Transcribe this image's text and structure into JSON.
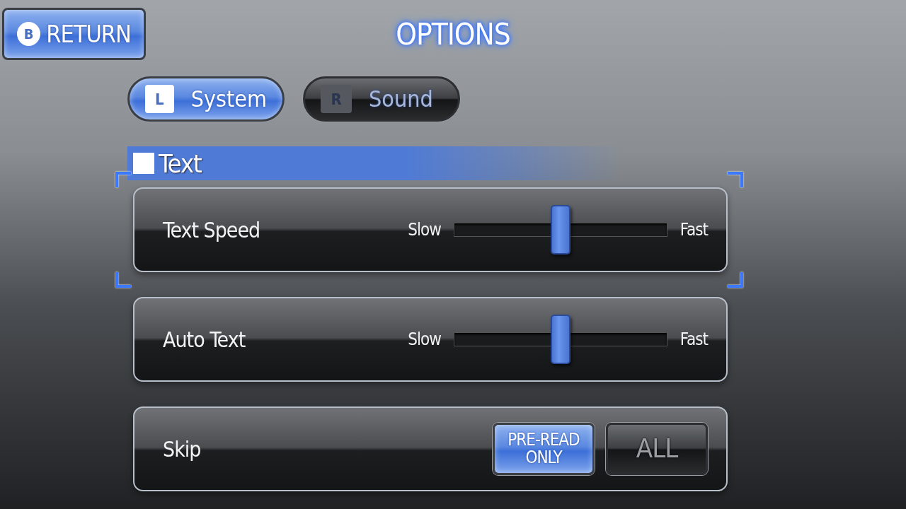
{
  "return_button": {
    "key": "B",
    "label": "RETURN"
  },
  "title": "OPTIONS",
  "tabs": [
    {
      "key": "L",
      "label": "System",
      "selected": true
    },
    {
      "key": "R",
      "label": "Sound",
      "selected": false
    }
  ],
  "section": {
    "label": "Text"
  },
  "settings": [
    {
      "kind": "slider",
      "label": "Text Speed",
      "min_label": "Slow",
      "max_label": "Fast",
      "level": 0.5,
      "focused": true
    },
    {
      "kind": "slider",
      "label": "Auto Text",
      "min_label": "Slow",
      "max_label": "Fast",
      "level": 0.5,
      "focused": false
    },
    {
      "kind": "choice",
      "label": "Skip",
      "focused": false,
      "options": [
        {
          "label": "PRE-READ ONLY",
          "selected": true
        },
        {
          "label": "ALL",
          "selected": false
        }
      ]
    }
  ]
}
